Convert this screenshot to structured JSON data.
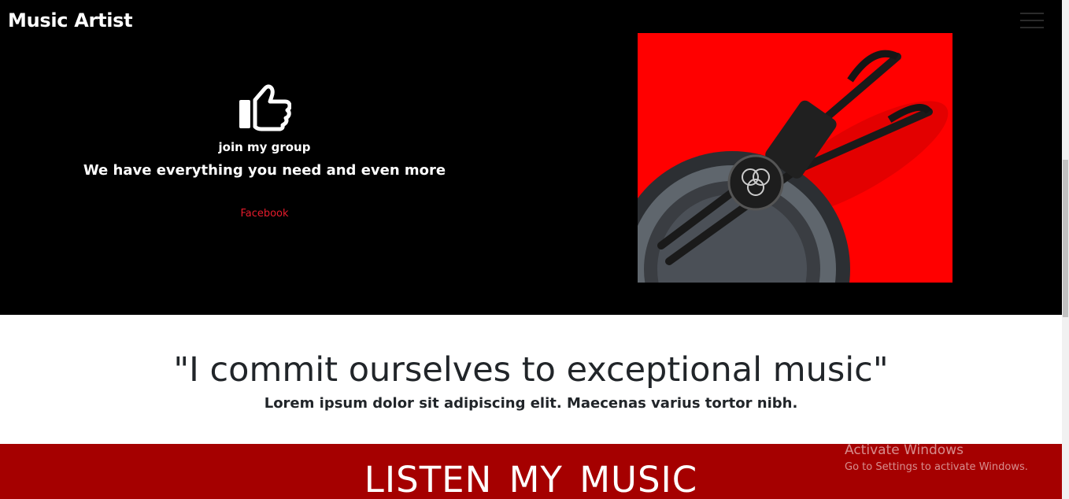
{
  "header": {
    "brand": "Music Artist",
    "menu_icon": "hamburger-menu-icon"
  },
  "promo": {
    "icon": "thumbs-up-icon",
    "title": "join my group",
    "subtitle": "We have everything you need and even more",
    "link_label": "Facebook"
  },
  "hero_image": {
    "icon": "headphones-image"
  },
  "quote_section": {
    "quote": "\"I commit ourselves to exceptional music\"",
    "subtext": "Lorem ipsum dolor sit adipiscing elit. Maecenas varius tortor nibh."
  },
  "music_section": {
    "title": "LISTEN  MY  MUSIC"
  },
  "watermark": {
    "title": "Activate Windows",
    "subtitle": "Go to Settings to activate Windows."
  },
  "colors": {
    "hero_bg": "#000000",
    "accent_link": "#e51b2b",
    "image_bg": "#ff0000",
    "music_bg": "#a50000",
    "text_dark": "#212529"
  }
}
